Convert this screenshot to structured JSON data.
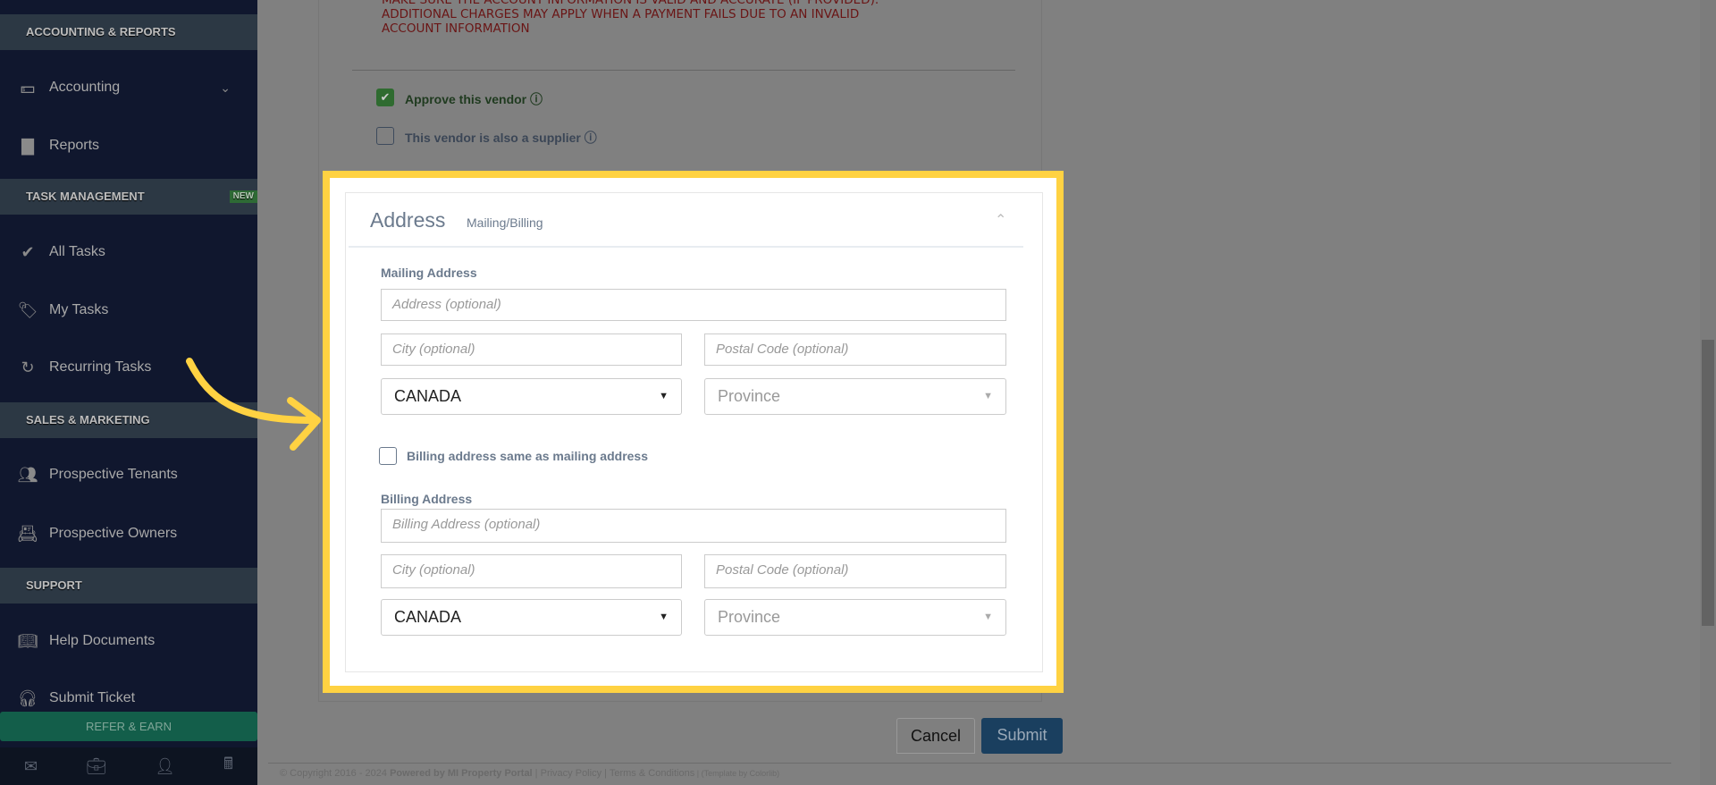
{
  "sidebar": {
    "sections": {
      "accounting": "ACCOUNTING & REPORTS",
      "tasks": "TASK MANAGEMENT",
      "tasks_badge": "NEW",
      "sales": "SALES & MARKETING",
      "support": "SUPPORT"
    },
    "items": {
      "accounting": "Accounting",
      "reports": "Reports",
      "all_tasks": "All Tasks",
      "my_tasks": "My Tasks",
      "recurring": "Recurring Tasks",
      "tenants": "Prospective Tenants",
      "owners": "Prospective Owners",
      "help": "Help Documents",
      "ticket": "Submit Ticket"
    },
    "refer": "REFER & EARN"
  },
  "warning": {
    "line1": "MAKE SURE THE ACCOUNT INFORMATION IS VALID AND ACCURATE (IF PROVIDED).",
    "line2": "ADDITIONAL CHARGES MAY APPLY WHEN A PAYMENT FAILS DUE TO AN INVALID",
    "line3": "ACCOUNT INFORMATION"
  },
  "vendor": {
    "approve": "Approve this vendor",
    "approve_checked": true,
    "supplier": "This vendor is also a supplier",
    "supplier_checked": false
  },
  "address": {
    "title": "Address",
    "subtitle": "Mailing/Billing",
    "mailing_label": "Mailing Address",
    "mailing_address_ph": "Address (optional)",
    "mailing_city_ph": "City (optional)",
    "mailing_postal_ph": "Postal Code (optional)",
    "mailing_country": "CANADA",
    "mailing_province": "Province",
    "same_label": "Billing address same as mailing address",
    "billing_label": "Billing Address",
    "billing_address_ph": "Billing Address (optional)",
    "billing_city_ph": "City (optional)",
    "billing_postal_ph": "Postal Code (optional)",
    "billing_country": "CANADA",
    "billing_province": "Province"
  },
  "actions": {
    "cancel": "Cancel",
    "submit": "Submit"
  },
  "footer": {
    "copyright": "© Copyright 2016 - 2024 ",
    "powered": "Powered by MI Property Portal",
    "sep1": " | ",
    "privacy": "Privacy Policy",
    "sep2": " | ",
    "terms": "Terms & Conditions",
    "template": " | (Template by Colorlib)"
  },
  "colors": {
    "highlight": "#ffd242",
    "submit": "#1a3f5f",
    "refer": "#135e4a"
  }
}
